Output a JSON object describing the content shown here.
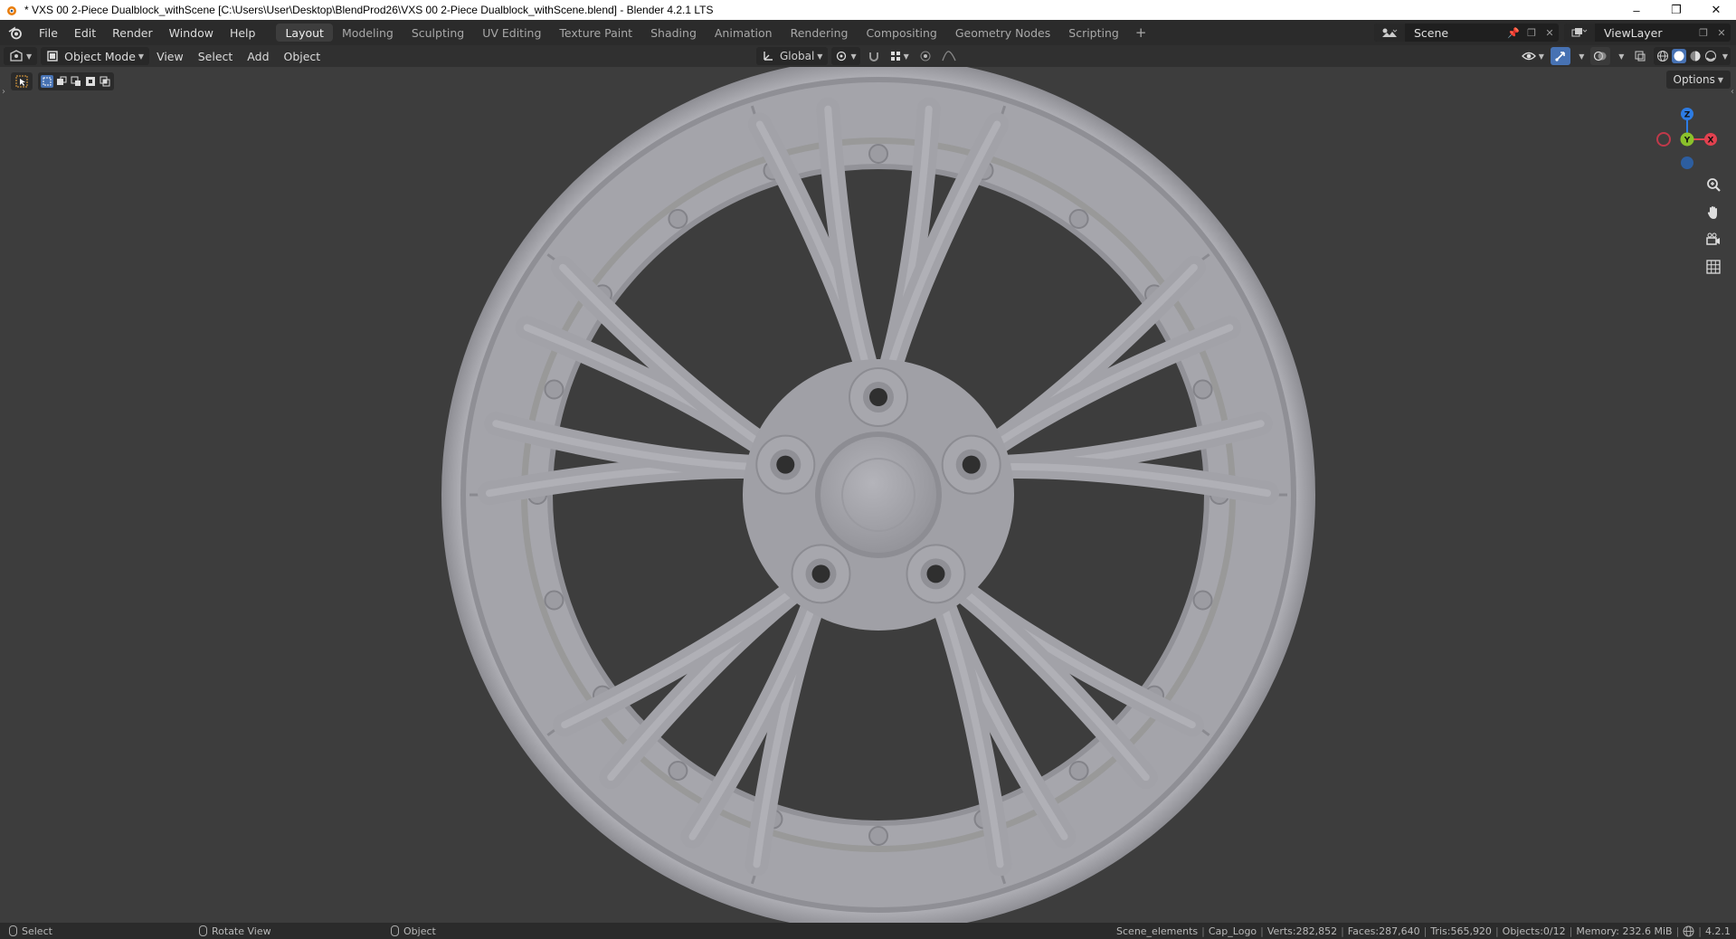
{
  "window": {
    "title": "* VXS 00 2-Piece Dualblock_withScene [C:\\Users\\User\\Desktop\\BlendProd26\\VXS 00 2-Piece Dualblock_withScene.blend] - Blender 4.2.1 LTS",
    "minimize": "–",
    "maximize": "❐",
    "close": "✕"
  },
  "menu": {
    "file": "File",
    "edit": "Edit",
    "render": "Render",
    "window": "Window",
    "help": "Help"
  },
  "workspaces": [
    "Layout",
    "Modeling",
    "Sculpting",
    "UV Editing",
    "Texture Paint",
    "Shading",
    "Animation",
    "Rendering",
    "Compositing",
    "Geometry Nodes",
    "Scripting"
  ],
  "workspace_add": "+",
  "scene": {
    "name": "Scene",
    "view_layer": "ViewLayer"
  },
  "viewport_header": {
    "mode": "Object Mode",
    "view": "View",
    "select": "Select",
    "add": "Add",
    "object": "Object",
    "orientation": "Global"
  },
  "viewport": {
    "options": "Options",
    "gizmo_axes": {
      "z": "Z",
      "y": "Y",
      "x": "X"
    },
    "colors": {
      "x_axis": "#e2414f",
      "y_axis": "#8bc12b",
      "z_axis": "#2d7ce4",
      "wheel": "#a8a8ae",
      "background": "#3d3d3d"
    }
  },
  "statusbar": {
    "select": "Select",
    "rotate": "Rotate View",
    "object": "Object",
    "collection": "Scene_elements",
    "active": "Cap_Logo",
    "verts": "Verts:282,852",
    "faces": "Faces:287,640",
    "tris": "Tris:565,920",
    "objects": "Objects:0/12",
    "memory": "Memory: 232.6 MiB",
    "version": "4.2.1"
  }
}
